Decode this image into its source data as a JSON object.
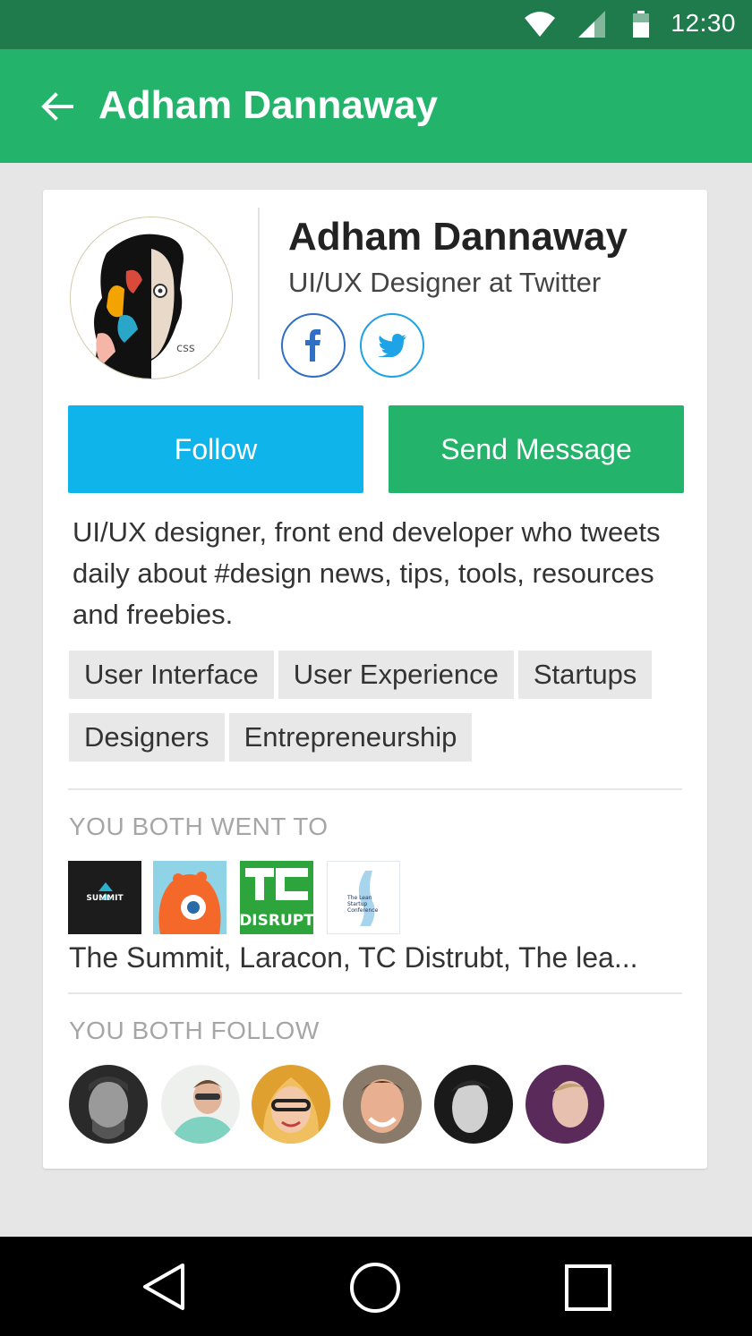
{
  "status_bar": {
    "time": "12:30"
  },
  "app_bar": {
    "title": "Adham Dannaway"
  },
  "profile": {
    "name": "Adham Dannaway",
    "job_title": "UI/UX Designer at Twitter",
    "follow_label": "Follow",
    "message_label": "Send Message",
    "bio": "UI/UX designer, front end developer who tweets daily about #design news, tips, tools, resources and freebies.",
    "tags": [
      "User Interface",
      "User Experience",
      "Startups",
      "Designers",
      "Entrepreneurship"
    ]
  },
  "went_to": {
    "label": "YOU BOTH WENT TO",
    "events": [
      {
        "name": "summit-logo",
        "text": "SUMMIT"
      },
      {
        "name": "laracon-logo"
      },
      {
        "name": "tc-disrupt-logo",
        "text_top": "TC",
        "text_bottom": "DISRUPT"
      },
      {
        "name": "lean-startup-logo",
        "text": "The Lean Startup Conference"
      }
    ],
    "summary": "The Summit, Laracon, TC Distrubt, The lea..."
  },
  "follow": {
    "label": "YOU BOTH FOLLOW"
  },
  "colors": {
    "status_bar": "#1f7a4c",
    "app_bar": "#23b36a",
    "follow_button": "#0fb4ea",
    "message_button": "#23b36a",
    "facebook": "#2f6fc4",
    "twitter": "#1da3e6"
  },
  "icons": [
    "back-arrow-icon",
    "wifi-icon",
    "signal-icon",
    "battery-icon",
    "facebook-icon",
    "twitter-icon",
    "nav-back-icon",
    "nav-home-icon",
    "nav-recents-icon"
  ]
}
